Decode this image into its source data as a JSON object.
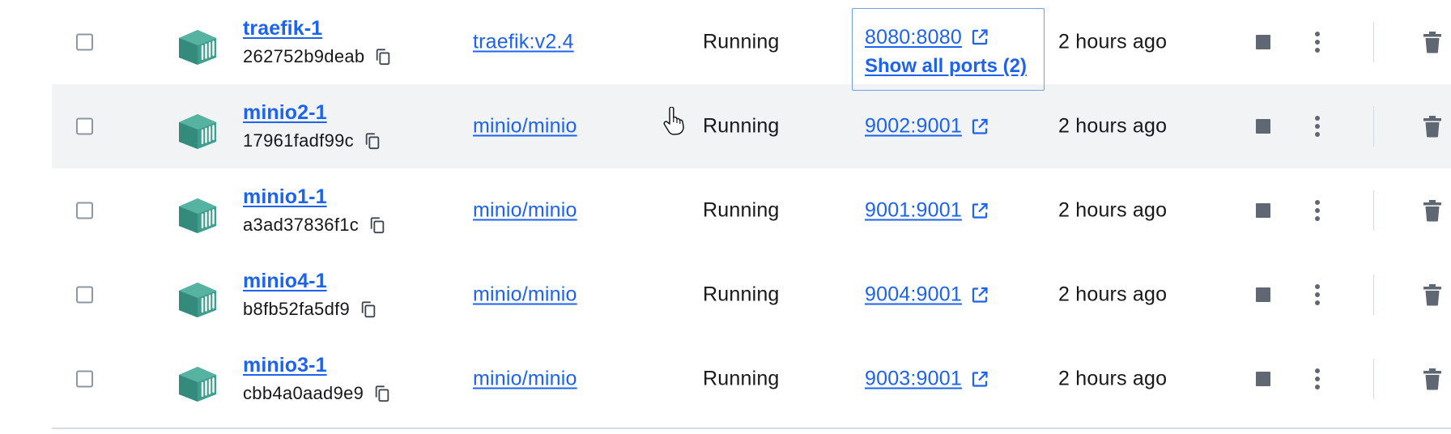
{
  "colors": {
    "link": "#1d63ed",
    "icon_teal": "#3e9f8e",
    "text": "#17181c",
    "hover_row": "#f1f3f5",
    "action_icon": "#5f6773"
  },
  "icons": {
    "container": "container-icon",
    "copy": "copy-icon",
    "external_link": "external-link-icon",
    "stop": "stop-icon",
    "more": "more-vertical-icon",
    "delete": "trash-icon",
    "cursor": "hand-pointer-cursor"
  },
  "rows": [
    {
      "name": "traefik-1",
      "id": "262752b9deab",
      "image": "traefik:v2.4",
      "status": "Running",
      "port": "8080:8080",
      "show_all_ports": "Show all ports (2)",
      "started": "2 hours ago"
    },
    {
      "name": "minio2-1",
      "id": "17961fadf99c",
      "image": "minio/minio",
      "status": "Running",
      "port": "9002:9001",
      "started": "2 hours ago"
    },
    {
      "name": "minio1-1",
      "id": "a3ad37836f1c",
      "image": "minio/minio",
      "status": "Running",
      "port": "9001:9001",
      "started": "2 hours ago"
    },
    {
      "name": "minio4-1",
      "id": "b8fb52fa5df9",
      "image": "minio/minio",
      "status": "Running",
      "port": "9004:9001",
      "started": "2 hours ago"
    },
    {
      "name": "minio3-1",
      "id": "cbb4a0aad9e9",
      "image": "minio/minio",
      "status": "Running",
      "port": "9003:9001",
      "started": "2 hours ago"
    }
  ]
}
